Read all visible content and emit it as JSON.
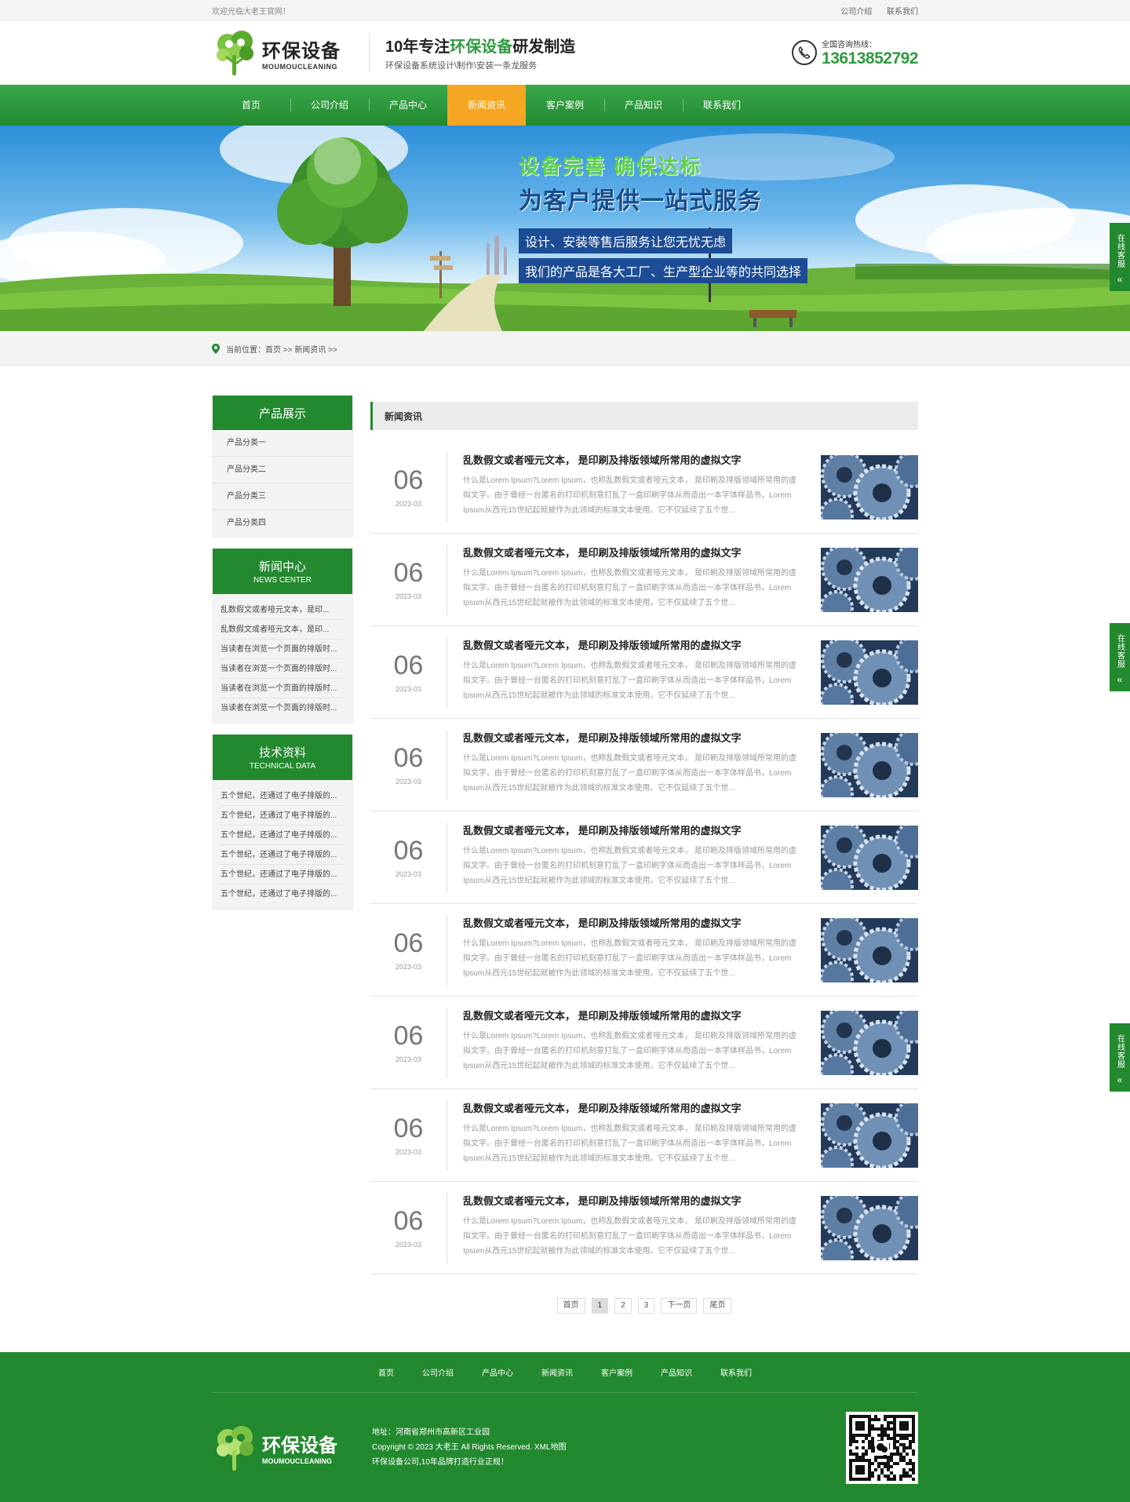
{
  "topbar": {
    "welcome": "欢迎光临大老王官网！",
    "links": [
      "公司介绍",
      "联系我们"
    ]
  },
  "header": {
    "logo_cn": "环保设备",
    "logo_en": "MOUMOUCLEANING",
    "slogan_prefix": "10年专注",
    "slogan_highlight": "环保设备",
    "slogan_suffix": "研发制造",
    "slogan_sub": "环保设备系统设计\\制作\\安装一条龙服务",
    "hotline_label": "全国咨询热线：",
    "hotline_number": "13613852792"
  },
  "nav": {
    "items": [
      "首页",
      "公司介绍",
      "产品中心",
      "新闻资讯",
      "客户案例",
      "产品知识",
      "联系我们"
    ],
    "active_index": 3
  },
  "banner": {
    "line1": "设备完善 确保达标",
    "line2": "为客户提供一站式服务",
    "tag1": "设计、安装等售后服务让您无忧无虑",
    "tag2": "我们的产品是各大工厂、生产型企业等的共同选择"
  },
  "breadcrumb": {
    "text": "当前位置：首页 >> 新闻资讯 >>"
  },
  "sidebar": {
    "products": {
      "title": "产品展示",
      "items": [
        "产品分类一",
        "产品分类二",
        "产品分类三",
        "产品分类四"
      ]
    },
    "news": {
      "title": "新闻中心",
      "title_en": "NEWS CENTER",
      "items": [
        "乱数假文或者哑元文本，是印...",
        "乱数假文或者哑元文本，是印...",
        "当读者在浏览一个页面的排版时...",
        "当读者在浏览一个页面的排版时...",
        "当读者在浏览一个页面的排版时...",
        "当读者在浏览一个页面的排版时..."
      ]
    },
    "tech": {
      "title": "技术资料",
      "title_en": "TECHNICAL DATA",
      "items": [
        "五个世纪，还通过了电子排版的...",
        "五个世纪，还通过了电子排版的...",
        "五个世纪，还通过了电子排版的...",
        "五个世纪，还通过了电子排版的...",
        "五个世纪，还通过了电子排版的...",
        "五个世纪，还通过了电子排版的..."
      ]
    }
  },
  "content": {
    "title": "新闻资讯",
    "news": [
      {
        "day": "06",
        "ym": "2023-03",
        "title": "乱数假文或者哑元文本， 是印刷及排版领域所常用的虚拟文字",
        "desc": "什么是Lorem Ipsum?Lorem Ipsum，也称乱数假文或者哑元文本， 是印刷及排版领域所常用的虚拟文字。由于曾经一台匿名的打印机刻意打乱了一盒印刷字体从而造出一本字体样品书，Lorem Ipsum从西元15世纪起就被作为此领域的标准文本使用。它不仅延续了五个世..."
      },
      {
        "day": "06",
        "ym": "2023-03",
        "title": "乱数假文或者哑元文本， 是印刷及排版领域所常用的虚拟文字",
        "desc": "什么是Lorem Ipsum?Lorem Ipsum，也称乱数假文或者哑元文本， 是印刷及排版领域所常用的虚拟文字。由于曾经一台匿名的打印机刻意打乱了一盒印刷字体从而造出一本字体样品书，Lorem Ipsum从西元15世纪起就被作为此领域的标准文本使用。它不仅延续了五个世..."
      },
      {
        "day": "06",
        "ym": "2023-03",
        "title": "乱数假文或者哑元文本， 是印刷及排版领域所常用的虚拟文字",
        "desc": "什么是Lorem Ipsum?Lorem Ipsum，也称乱数假文或者哑元文本， 是印刷及排版领域所常用的虚拟文字。由于曾经一台匿名的打印机刻意打乱了一盒印刷字体从而造出一本字体样品书，Lorem Ipsum从西元15世纪起就被作为此领域的标准文本使用。它不仅延续了五个世..."
      },
      {
        "day": "06",
        "ym": "2023-03",
        "title": "乱数假文或者哑元文本， 是印刷及排版领域所常用的虚拟文字",
        "desc": "什么是Lorem Ipsum?Lorem Ipsum，也称乱数假文或者哑元文本， 是印刷及排版领域所常用的虚拟文字。由于曾经一台匿名的打印机刻意打乱了一盒印刷字体从而造出一本字体样品书，Lorem Ipsum从西元15世纪起就被作为此领域的标准文本使用。它不仅延续了五个世..."
      },
      {
        "day": "06",
        "ym": "2023-03",
        "title": "乱数假文或者哑元文本， 是印刷及排版领域所常用的虚拟文字",
        "desc": "什么是Lorem Ipsum?Lorem Ipsum，也称乱数假文或者哑元文本， 是印刷及排版领域所常用的虚拟文字。由于曾经一台匿名的打印机刻意打乱了一盒印刷字体从而造出一本字体样品书，Lorem Ipsum从西元15世纪起就被作为此领域的标准文本使用。它不仅延续了五个世..."
      },
      {
        "day": "06",
        "ym": "2023-03",
        "title": "乱数假文或者哑元文本， 是印刷及排版领域所常用的虚拟文字",
        "desc": "什么是Lorem Ipsum?Lorem Ipsum，也称乱数假文或者哑元文本， 是印刷及排版领域所常用的虚拟文字。由于曾经一台匿名的打印机刻意打乱了一盒印刷字体从而造出一本字体样品书，Lorem Ipsum从西元15世纪起就被作为此领域的标准文本使用。它不仅延续了五个世..."
      },
      {
        "day": "06",
        "ym": "2023-03",
        "title": "乱数假文或者哑元文本， 是印刷及排版领域所常用的虚拟文字",
        "desc": "什么是Lorem Ipsum?Lorem Ipsum，也称乱数假文或者哑元文本， 是印刷及排版领域所常用的虚拟文字。由于曾经一台匿名的打印机刻意打乱了一盒印刷字体从而造出一本字体样品书，Lorem Ipsum从西元15世纪起就被作为此领域的标准文本使用。它不仅延续了五个世..."
      },
      {
        "day": "06",
        "ym": "2023-03",
        "title": "乱数假文或者哑元文本， 是印刷及排版领域所常用的虚拟文字",
        "desc": "什么是Lorem Ipsum?Lorem Ipsum，也称乱数假文或者哑元文本， 是印刷及排版领域所常用的虚拟文字。由于曾经一台匿名的打印机刻意打乱了一盒印刷字体从而造出一本字体样品书，Lorem Ipsum从西元15世纪起就被作为此领域的标准文本使用。它不仅延续了五个世..."
      },
      {
        "day": "06",
        "ym": "2023-03",
        "title": "乱数假文或者哑元文本， 是印刷及排版领域所常用的虚拟文字",
        "desc": "什么是Lorem Ipsum?Lorem Ipsum，也称乱数假文或者哑元文本， 是印刷及排版领域所常用的虚拟文字。由于曾经一台匿名的打印机刻意打乱了一盒印刷字体从而造出一本字体样品书，Lorem Ipsum从西元15世纪起就被作为此领域的标准文本使用。它不仅延续了五个世..."
      }
    ]
  },
  "pager": {
    "first": "首页",
    "pages": [
      "1",
      "2",
      "3"
    ],
    "current": "1",
    "next": "下一页",
    "last": "尾页"
  },
  "footer": {
    "nav": [
      "首页",
      "公司介绍",
      "产品中心",
      "新闻资讯",
      "客户案例",
      "产品知识",
      "联系我们"
    ],
    "logo_cn": "环保设备",
    "logo_en": "MOUMOUCLEANING",
    "address": "地址：河南省郑州市高新区工业园",
    "copyright": "Copyright © 2023 大老王 All Rights Reserved. XML地图",
    "tagline": "环保设备公司,10年品牌打造行业正规！"
  },
  "kefu": {
    "label": "在线客服",
    "chevron": "«"
  },
  "colors": {
    "brand_green": "#23892f",
    "nav_active": "#f5a623",
    "banner_tag_blue": "#1c4c95"
  },
  "icons": {
    "hotline": "phone-icon",
    "breadcrumb": "location-pin-icon",
    "logo": "tree-icon",
    "footer_qr": "qr-code-icon"
  }
}
